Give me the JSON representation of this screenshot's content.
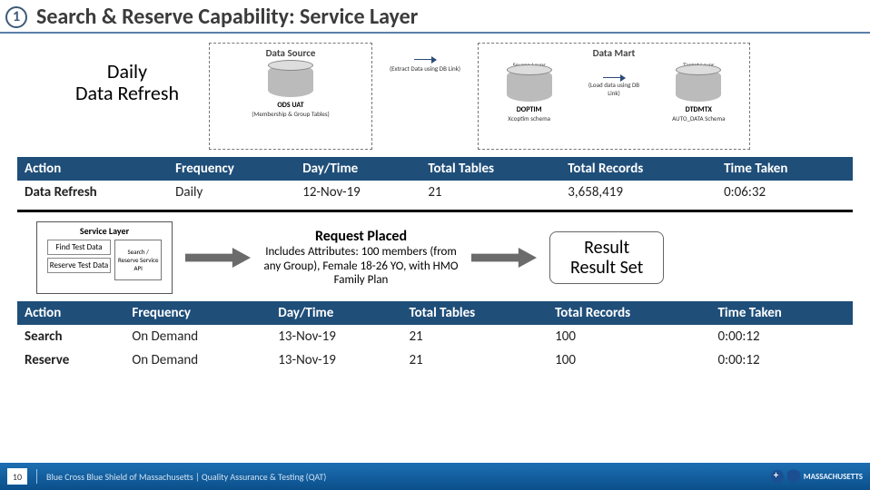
{
  "header": {
    "number": "1",
    "title": "Search & Reserve Capability: Service Layer"
  },
  "daily_refresh": {
    "line1": "Daily",
    "line2": "Data Refresh"
  },
  "diagram": {
    "data_source": {
      "title": "Data Source",
      "db_label": "ODS UAT",
      "db_sub": "(Membership & Group Tables)"
    },
    "arrow1_note": "(Extract Data using DB Link)",
    "data_mart": {
      "title": "Data Mart",
      "left_head": "Source Layer",
      "right_head": "Target Layer",
      "left_db": "DOPTIM",
      "left_sub": "Xcoptim schema",
      "arrow2_note": "(Load data using DB Link)",
      "right_db": "DTDMTX",
      "right_sub": "AUTO_DATA Schema"
    }
  },
  "table1": {
    "headers": [
      "Action",
      "Frequency",
      "Day/Time",
      "Total Tables",
      "Total Records",
      "Time Taken"
    ],
    "rows": [
      {
        "action": "Data Refresh",
        "freq": "Daily",
        "day": "12-Nov-19",
        "tables": "21",
        "records": "3,658,419",
        "time": "0:06:32"
      }
    ]
  },
  "service_layer": {
    "title": "Service Layer",
    "box_a": "Find Test Data",
    "box_b": "Reserve Test Data",
    "box_c": "Search / Reserve Service API"
  },
  "request": {
    "title": "Request Placed",
    "body": "Includes Attributes: 100 members (from any Group), Female 18-26 YO, with HMO Family Plan"
  },
  "result": {
    "line1": "Result",
    "line2": "Result Set"
  },
  "table2": {
    "headers": [
      "Action",
      "Frequency",
      "Day/Time",
      "Total Tables",
      "Total Records",
      "Time Taken"
    ],
    "rows": [
      {
        "action": "Search",
        "freq": "On Demand",
        "day": "13-Nov-19",
        "tables": "21",
        "records": "100",
        "time": "0:00:12"
      },
      {
        "action": "Reserve",
        "freq": "On Demand",
        "day": "13-Nov-19",
        "tables": "21",
        "records": "100",
        "time": "0:00:12"
      }
    ]
  },
  "footer": {
    "page": "10",
    "text": "Blue Cross Blue Shield of Massachusetts | Quality Assurance & Testing (QAT)",
    "brand": "MASSACHUSETTS"
  }
}
